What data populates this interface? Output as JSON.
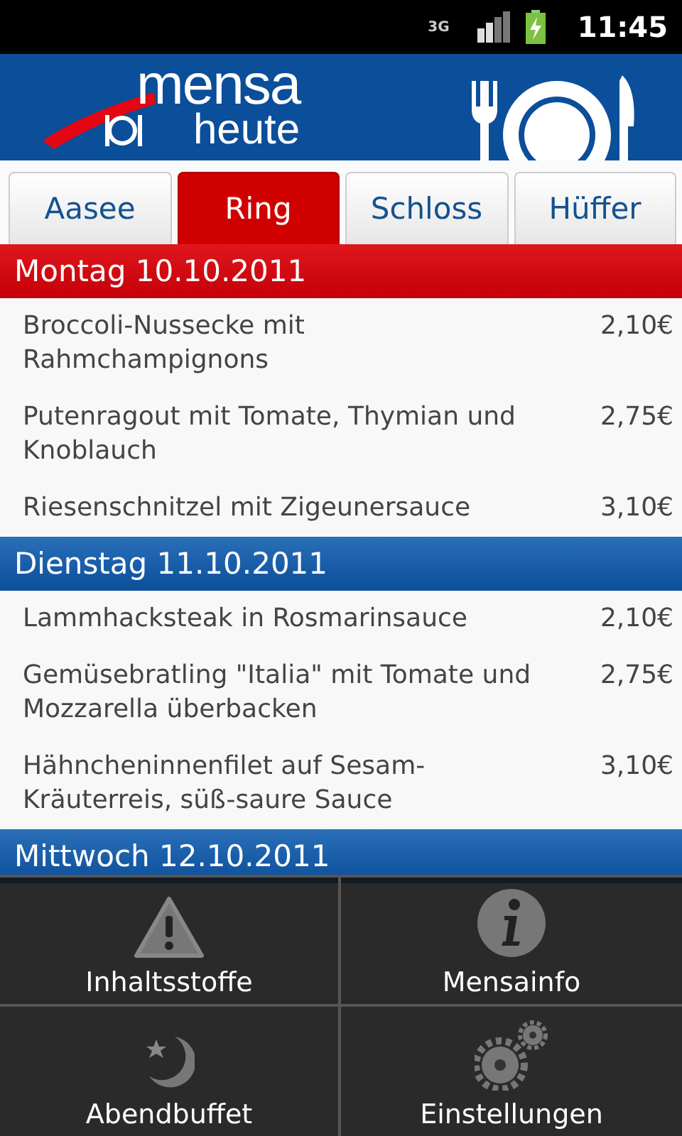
{
  "status_bar": {
    "network_type": "3G",
    "time": "11:45"
  },
  "header": {
    "logo_top": "mensa",
    "logo_bottom": "heute"
  },
  "tabs": [
    {
      "label": "Aasee",
      "selected": false
    },
    {
      "label": "Ring",
      "selected": true
    },
    {
      "label": "Schloss",
      "selected": false
    },
    {
      "label": "Hüffer",
      "selected": false
    }
  ],
  "days": [
    {
      "title": "Montag 10.10.2011",
      "highlighted": true,
      "dishes": [
        {
          "name": "Broccoli-Nussecke mit Rahmchampignons",
          "price": "2,10€"
        },
        {
          "name": "Putenragout mit Tomate, Thymian und Knoblauch",
          "price": "2,75€"
        },
        {
          "name": "Riesenschnitzel mit Zigeunersauce",
          "price": "3,10€"
        }
      ]
    },
    {
      "title": "Dienstag 11.10.2011",
      "highlighted": false,
      "dishes": [
        {
          "name": "Lammhacksteak in Rosmarinsauce",
          "price": "2,10€"
        },
        {
          "name": "Gemüsebratling \"Italia\" mit Tomate und Mozzarella überbacken",
          "price": "2,75€"
        },
        {
          "name": "Hähncheninnenfilet auf Sesam-Kräuterreis, süß-saure Sauce",
          "price": "3,10€"
        }
      ]
    },
    {
      "title": "Mittwoch 12.10.2011",
      "highlighted": false
    }
  ],
  "menu": [
    {
      "label": "Inhaltsstoffe",
      "kind": "warning"
    },
    {
      "label": "Mensainfo",
      "kind": "info"
    },
    {
      "label": "Abendbuffet",
      "kind": "night"
    },
    {
      "label": "Einstellungen",
      "kind": "settings"
    }
  ]
}
